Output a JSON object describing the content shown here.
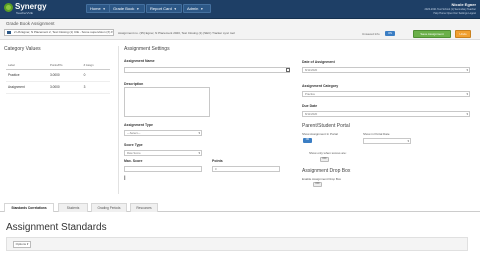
{
  "app": {
    "logo_name": "Synergy",
    "logo_sub": "TeacherVUE",
    "nav": [
      "Home",
      "Grade Book",
      "Report Card",
      "Admin"
    ],
    "user_name": "Nicole Egner",
    "user_line1": "2020-2021 Test School (1)   Secondary Teacher",
    "user_line2": "Help   Home   Open Doc   Settings   Logout"
  },
  "toolbar": {
    "title": "Grade Book Assignment",
    "context": "2 HS Egner, N Placement 2, Test Closing (1) CIE - Some supervision (X) ▾",
    "context_text": "Assignment no. (35) Egner, N Placement 2020, Test Closing (1) (SEC) Tracker sync tool",
    "changes_label": "Unsaved Info",
    "changes_toggle": "ON",
    "save_label": "Save Assignment",
    "orange_label": "Undo"
  },
  "category": {
    "heading": "Category Values",
    "columns": [
      "Label",
      "Points/Pts",
      "# Assgn"
    ],
    "rows": [
      {
        "label": "Practice",
        "points": "3.0000",
        "count": "0"
      },
      {
        "label": "Assignment",
        "points": "3.0000",
        "count": "3"
      }
    ]
  },
  "assignment": {
    "heading": "Assignment Settings",
    "name_label": "Assignment Name",
    "desc_label": "Description",
    "type_label": "Assignment Type",
    "type_value": "—Select—",
    "score_type_label": "Score Type",
    "score_type_value": "Raw Score",
    "max_score_label": "Max. Score",
    "points_label": "Points",
    "points_value": "0",
    "date_label": "Date of Assignment",
    "date_value": "8/11/2020",
    "category_label": "Assignment Category",
    "category_value": "Practice",
    "due_label": "Due Date",
    "due_value": "8/11/2020",
    "portal_heading": "Parent/Student Portal",
    "show_portal": "Show Assignment In Portal",
    "show_portal_toggle": "ON",
    "show_portal_date": "Show in Portal Date",
    "show_scores": "Show only when scores are:",
    "show_scores_toggle": "OFF",
    "dropbox_heading": "Assignment Drop Box",
    "enable_dropbox": "Enable Assignment Drop Box",
    "enable_dropbox_toggle": "OFF"
  },
  "tabs": [
    "Standards Correlations",
    "Students",
    "Grading Periods",
    "Resources"
  ],
  "standards": {
    "title": "Assignment Standards",
    "options_label": "Options ▾"
  }
}
